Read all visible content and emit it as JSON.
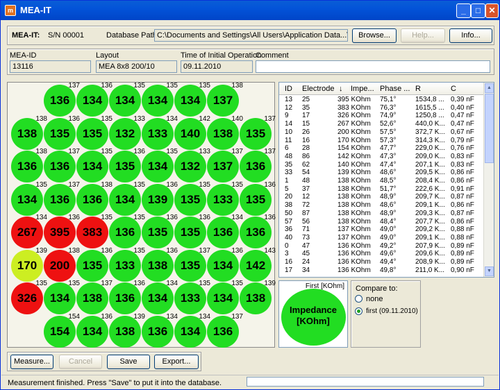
{
  "window": {
    "title": "MEA-IT",
    "app_icon_label": "m"
  },
  "header": {
    "device_label": "MEA-IT:",
    "serial": "S/N 00001",
    "db_path_label": "Database Path:",
    "db_path": "C:\\Documents and Settings\\All Users\\Application Data...\\Database",
    "browse": "Browse...",
    "help": "Help...",
    "info": "Info..."
  },
  "meta": {
    "mea_id_label": "MEA-ID",
    "mea_id": "13116",
    "layout_label": "Layout",
    "layout": "MEA 8x8 200/10",
    "time_label": "Time of Initial Operation",
    "time": "09.11.2010",
    "comment_label": "Comment",
    "comment": ""
  },
  "colors": {
    "green": "#22dd22",
    "red": "#ee1111",
    "yellow": "#ccee22"
  },
  "electrodes": [
    [
      null,
      {
        "id": "137",
        "v": "136",
        "c": "green"
      },
      {
        "id": "136",
        "v": "134",
        "c": "green"
      },
      {
        "id": "135",
        "v": "134",
        "c": "green"
      },
      {
        "id": "135",
        "v": "134",
        "c": "green"
      },
      {
        "id": "135",
        "v": "134",
        "c": "green"
      },
      {
        "id": "138",
        "v": "137",
        "c": "green"
      },
      null
    ],
    [
      {
        "id": "138",
        "v": "138",
        "c": "green"
      },
      {
        "id": "136",
        "v": "135",
        "c": "green"
      },
      {
        "id": "135",
        "v": "135",
        "c": "green"
      },
      {
        "id": "133",
        "v": "132",
        "c": "green"
      },
      {
        "id": "134",
        "v": "133",
        "c": "green"
      },
      {
        "id": "142",
        "v": "140",
        "c": "green"
      },
      {
        "id": "140",
        "v": "138",
        "c": "green"
      },
      {
        "id": "137",
        "v": "135",
        "c": "green"
      }
    ],
    [
      {
        "id": "138",
        "v": "136",
        "c": "green"
      },
      {
        "id": "137",
        "v": "136",
        "c": "green"
      },
      {
        "id": "135",
        "v": "134",
        "c": "green"
      },
      {
        "id": "136",
        "v": "135",
        "c": "green"
      },
      {
        "id": "135",
        "v": "134",
        "c": "green"
      },
      {
        "id": "133",
        "v": "132",
        "c": "green"
      },
      {
        "id": "137",
        "v": "137",
        "c": "green"
      },
      {
        "id": "137",
        "v": "136",
        "c": "green"
      }
    ],
    [
      {
        "id": "135",
        "v": "134",
        "c": "green"
      },
      {
        "id": "137",
        "v": "136",
        "c": "green"
      },
      {
        "id": "138",
        "v": "136",
        "c": "green"
      },
      {
        "id": "135",
        "v": "134",
        "c": "green"
      },
      {
        "id": "136",
        "v": "139",
        "c": "green"
      },
      {
        "id": "135",
        "v": "135",
        "c": "green"
      },
      {
        "id": "135",
        "v": "133",
        "c": "green"
      },
      {
        "id": "136",
        "v": "135",
        "c": "green"
      }
    ],
    [
      {
        "id": "134",
        "v": "267",
        "c": "red"
      },
      {
        "id": "136",
        "v": "395",
        "c": "red"
      },
      {
        "id": "135",
        "v": "383",
        "c": "red"
      },
      {
        "id": "135",
        "v": "136",
        "c": "green"
      },
      {
        "id": "136",
        "v": "135",
        "c": "green"
      },
      {
        "id": "136",
        "v": "135",
        "c": "green"
      },
      {
        "id": "134",
        "v": "136",
        "c": "green"
      },
      {
        "id": "136",
        "v": "136",
        "c": "green"
      }
    ],
    [
      {
        "id": "139",
        "v": "170",
        "c": "yellow"
      },
      {
        "id": "138",
        "v": "200",
        "c": "red"
      },
      {
        "id": "136",
        "v": "135",
        "c": "green"
      },
      {
        "id": "135",
        "v": "133",
        "c": "green"
      },
      {
        "id": "136",
        "v": "138",
        "c": "green"
      },
      {
        "id": "137",
        "v": "135",
        "c": "green"
      },
      {
        "id": "136",
        "v": "134",
        "c": "green"
      },
      {
        "id": "143",
        "v": "142",
        "c": "green"
      }
    ],
    [
      {
        "id": "135",
        "v": "326",
        "c": "red"
      },
      {
        "id": "135",
        "v": "134",
        "c": "green"
      },
      {
        "id": "137",
        "v": "138",
        "c": "green"
      },
      {
        "id": "136",
        "v": "136",
        "c": "green"
      },
      {
        "id": "134",
        "v": "134",
        "c": "green"
      },
      {
        "id": "135",
        "v": "133",
        "c": "green"
      },
      {
        "id": "135",
        "v": "134",
        "c": "green"
      },
      {
        "id": "139",
        "v": "138",
        "c": "green"
      }
    ],
    [
      null,
      {
        "id": "154",
        "v": "154",
        "c": "green"
      },
      {
        "id": "136",
        "v": "134",
        "c": "green"
      },
      {
        "id": "139",
        "v": "138",
        "c": "green"
      },
      {
        "id": "134",
        "v": "136",
        "c": "green"
      },
      {
        "id": "134",
        "v": "134",
        "c": "green"
      },
      {
        "id": "137",
        "v": "136",
        "c": "green"
      },
      null
    ]
  ],
  "table": {
    "headers": [
      "ID",
      "Electrode",
      "",
      "Impe...",
      "Phase ...",
      "R",
      "C"
    ],
    "sort_icon": "↓",
    "rows": [
      [
        "13",
        "25",
        "395 KOhm",
        "75,1°",
        "1534,8 ...",
        "0,39 nF"
      ],
      [
        "12",
        "35",
        "383 KOhm",
        "76,3°",
        "1615,5 ...",
        "0,40 nF"
      ],
      [
        "9",
        "17",
        "326 KOhm",
        "74,9°",
        "1250,8 ...",
        "0,47 nF"
      ],
      [
        "14",
        "15",
        "267 KOhm",
        "52,6°",
        "440,0 K...",
        "0,47 nF"
      ],
      [
        "10",
        "26",
        "200 KOhm",
        "57,5°",
        "372,7 K...",
        "0,67 nF"
      ],
      [
        "11",
        "16",
        "170 KOhm",
        "57,3°",
        "314,3 K...",
        "0,79 nF"
      ],
      [
        "6",
        "28",
        "154 KOhm",
        "47,7°",
        "229,0 K...",
        "0,76 nF"
      ],
      [
        "48",
        "86",
        "142 KOhm",
        "47,3°",
        "209,0 K...",
        "0,83 nF"
      ],
      [
        "35",
        "62",
        "140 KOhm",
        "47,4°",
        "207,1 K...",
        "0,83 nF"
      ],
      [
        "33",
        "54",
        "139 KOhm",
        "48,6°",
        "209,5 K...",
        "0,86 nF"
      ],
      [
        "1",
        "48",
        "138 KOhm",
        "48,5°",
        "208,4 K...",
        "0,86 nF"
      ],
      [
        "5",
        "37",
        "138 KOhm",
        "51,7°",
        "222,6 K...",
        "0,91 nF"
      ],
      [
        "20",
        "12",
        "138 KOhm",
        "48,9°",
        "209,7 K...",
        "0,87 nF"
      ],
      [
        "38",
        "72",
        "138 KOhm",
        "48,6°",
        "209,1 K...",
        "0,86 nF"
      ],
      [
        "50",
        "87",
        "138 KOhm",
        "48,9°",
        "209,3 K...",
        "0,87 nF"
      ],
      [
        "57",
        "56",
        "138 KOhm",
        "48,4°",
        "207,7 K...",
        "0,86 nF"
      ],
      [
        "36",
        "71",
        "137 KOhm",
        "49,0°",
        "209,2 K...",
        "0,88 nF"
      ],
      [
        "40",
        "73",
        "137 KOhm",
        "49,0°",
        "209,1 K...",
        "0,88 nF"
      ],
      [
        "0",
        "47",
        "136 KOhm",
        "49,2°",
        "207,9 K...",
        "0,89 nF"
      ],
      [
        "3",
        "45",
        "136 KOhm",
        "49,6°",
        "209,6 K...",
        "0,89 nF"
      ],
      [
        "16",
        "24",
        "136 KOhm",
        "49,4°",
        "208,9 K...",
        "0,89 nF"
      ],
      [
        "17",
        "34",
        "136 KOhm",
        "49,8°",
        "211,0 K...",
        "0,90 nF"
      ]
    ]
  },
  "legend": {
    "first_label": "First [KOhm]",
    "title": "Impedance",
    "unit": "[KOhm]"
  },
  "compare": {
    "title": "Compare to:",
    "opt_none": "none",
    "opt_first": "first (09.11.2010)"
  },
  "actions": {
    "measure": "Measure...",
    "cancel": "Cancel",
    "save": "Save",
    "export": "Export..."
  },
  "status": {
    "text": "Measurement finished. Press \"Save\" to put it into the database."
  }
}
